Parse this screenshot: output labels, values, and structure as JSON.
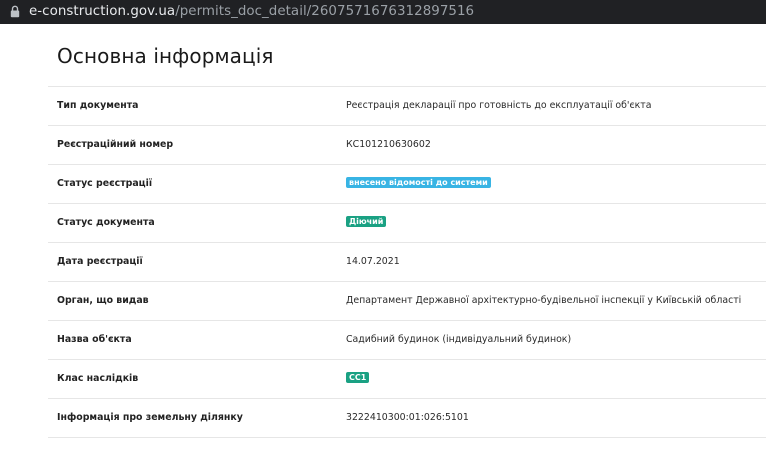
{
  "browser": {
    "url_host": "e-construction.gov.ua",
    "url_path": "/permits_doc_detail/2607571676312897516"
  },
  "page": {
    "title": "Основна інформація"
  },
  "rows": [
    {
      "label": "Тип документа",
      "value": "Реєстрація декларації про готовність до експлуатації об'єкта"
    },
    {
      "label": "Реєстраційний номер",
      "value": "КС101210630602"
    },
    {
      "label": "Статус реєстрації",
      "badge": "внесено відомості до системи",
      "badge_color": "#38b4e4"
    },
    {
      "label": "Статус документа",
      "badge": "Діючий",
      "badge_color": "#1aa183"
    },
    {
      "label": "Дата реєстрації",
      "value": "14.07.2021"
    },
    {
      "label": "Орган, що видав",
      "value": "Департамент Державної архітектурно-будівельної інспекції у Київській області"
    },
    {
      "label": "Назва об'єкта",
      "value": "Садибний будинок (індивідуальний будинок)"
    },
    {
      "label": "Клас наслідків",
      "badge": "СС1",
      "badge_color": "#1aa183"
    },
    {
      "label": "Інформація про земельну ділянку",
      "value": "3222410300:01:026:5101"
    }
  ]
}
